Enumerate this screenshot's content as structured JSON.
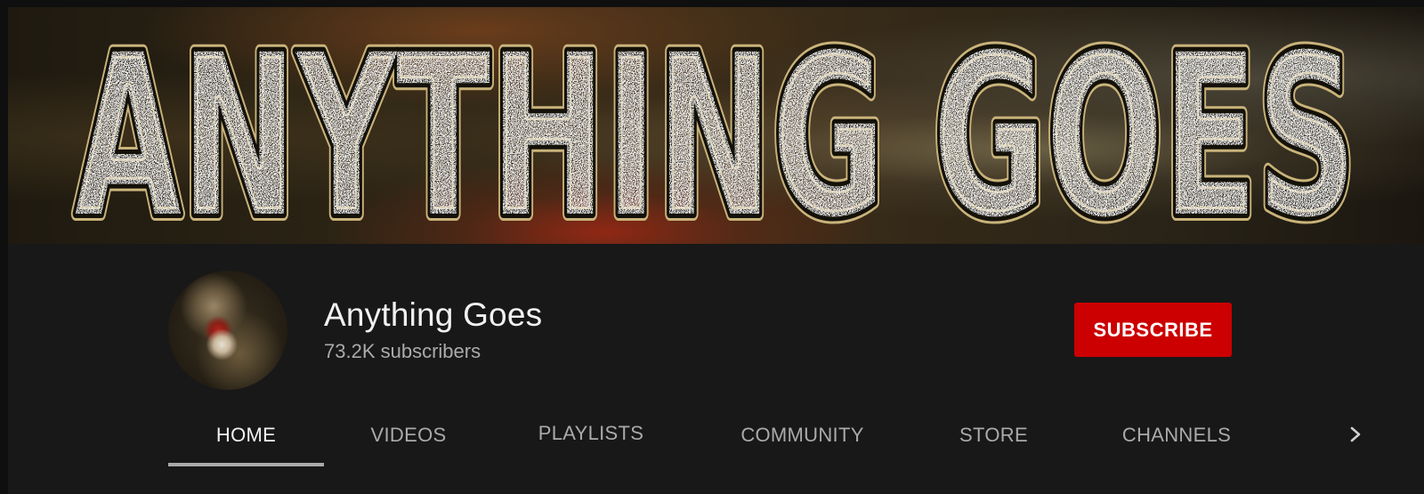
{
  "banner": {
    "title": "ANYTHING GOES"
  },
  "channel": {
    "name": "Anything Goes",
    "subscribers": "73.2K subscribers",
    "subscribe_label": "SUBSCRIBE",
    "avatar_icon": "channel-avatar"
  },
  "tabs": [
    {
      "label": "HOME",
      "active": true
    },
    {
      "label": "VIDEOS",
      "active": false
    },
    {
      "label": "PLAYLISTS",
      "active": false
    },
    {
      "label": "COMMUNITY",
      "active": false
    },
    {
      "label": "STORE",
      "active": false
    },
    {
      "label": "CHANNELS",
      "active": false
    }
  ],
  "nav": {
    "next_icon": "chevron-right-icon"
  },
  "colors": {
    "background": "#181818",
    "subscribe_button": "#cc0000",
    "text_primary": "#f1f1f1",
    "text_secondary": "#aaaaaa"
  }
}
